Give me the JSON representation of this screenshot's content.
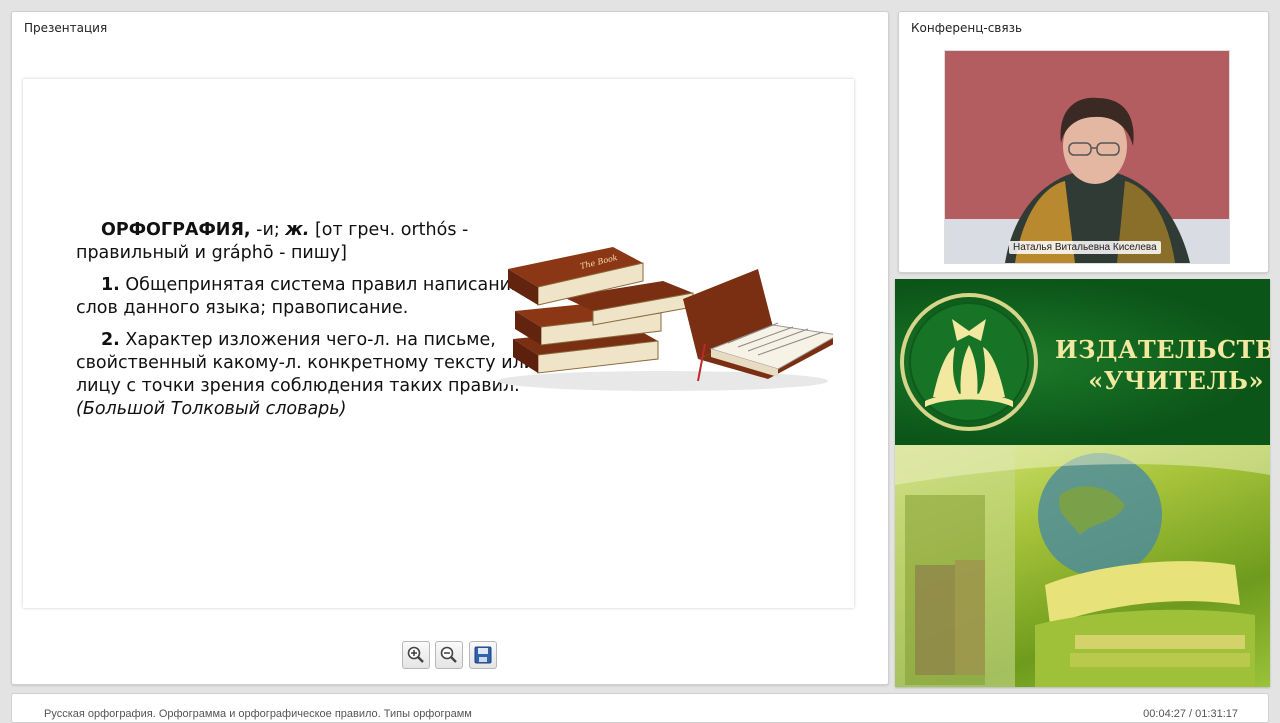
{
  "presentation": {
    "title": "Презентация",
    "slide": {
      "term": "ОРФОГРАФИЯ,",
      "term_suffix": " -и; ",
      "gender": "ж.",
      "etymology": " [от греч. orthós - правильный и gráphō - пишу]",
      "def1_num": "1.",
      "def1_text": " Общепринятая система правил написания слов данного языка; правописание.",
      "def2_num": "2.",
      "def2_text": " Характер изложения чего-л. на письме, свойственный какому-л. конкретному тексту или лицу с точки зрения соблюдения таких правил. ",
      "source": "(Большой Толковый словарь)",
      "book_label": "The Book"
    },
    "toolbar": {
      "zoom_in": "zoom-in-icon",
      "zoom_out": "zoom-out-icon",
      "save": "save-icon"
    }
  },
  "conference": {
    "title": "Конференц-связь",
    "speaker_name": "Наталья Витальевна Киселева"
  },
  "publisher": {
    "line1": "ИЗДАТЕЛЬСТВО",
    "line2": "«УЧИТЕЛЬ»",
    "colors": {
      "green": "#0b5518",
      "gold": "#f2e8a0"
    }
  },
  "footer": {
    "lesson_title": "Русская орфография. Орфограмма и орфографическое правило. Типы орфограмм",
    "time_current": "00:04:27",
    "time_separator": " / ",
    "time_total": "01:31:17"
  }
}
